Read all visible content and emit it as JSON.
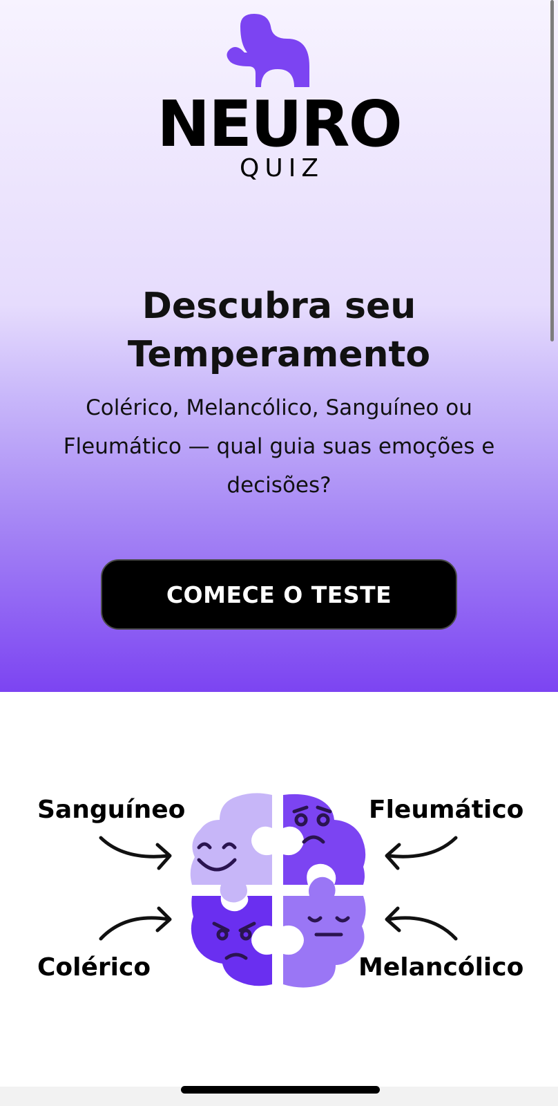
{
  "logo": {
    "word": "NEURO",
    "sub": "QUIZ",
    "mark_icon": "puzzle-piece-icon"
  },
  "hero": {
    "headline": "Descubra seu Temperamento",
    "subtext": "Colérico, Melancólico, Sanguíneo ou Fleumático — qual guia suas emoções e decisões?",
    "cta_label": "COMECE O TESTE"
  },
  "temperaments": {
    "top_left": "Sanguíneo",
    "top_right": "Fleumático",
    "bottom_left": "Colérico",
    "bottom_right": "Melancólico"
  },
  "colors": {
    "brand_purple": "#7c44f2",
    "light_purple": "#c7b6f8",
    "mid_purple": "#9a76f5",
    "dark_purple": "#6a2ff0",
    "button_bg": "#000000",
    "face_stroke": "#2a1450"
  }
}
